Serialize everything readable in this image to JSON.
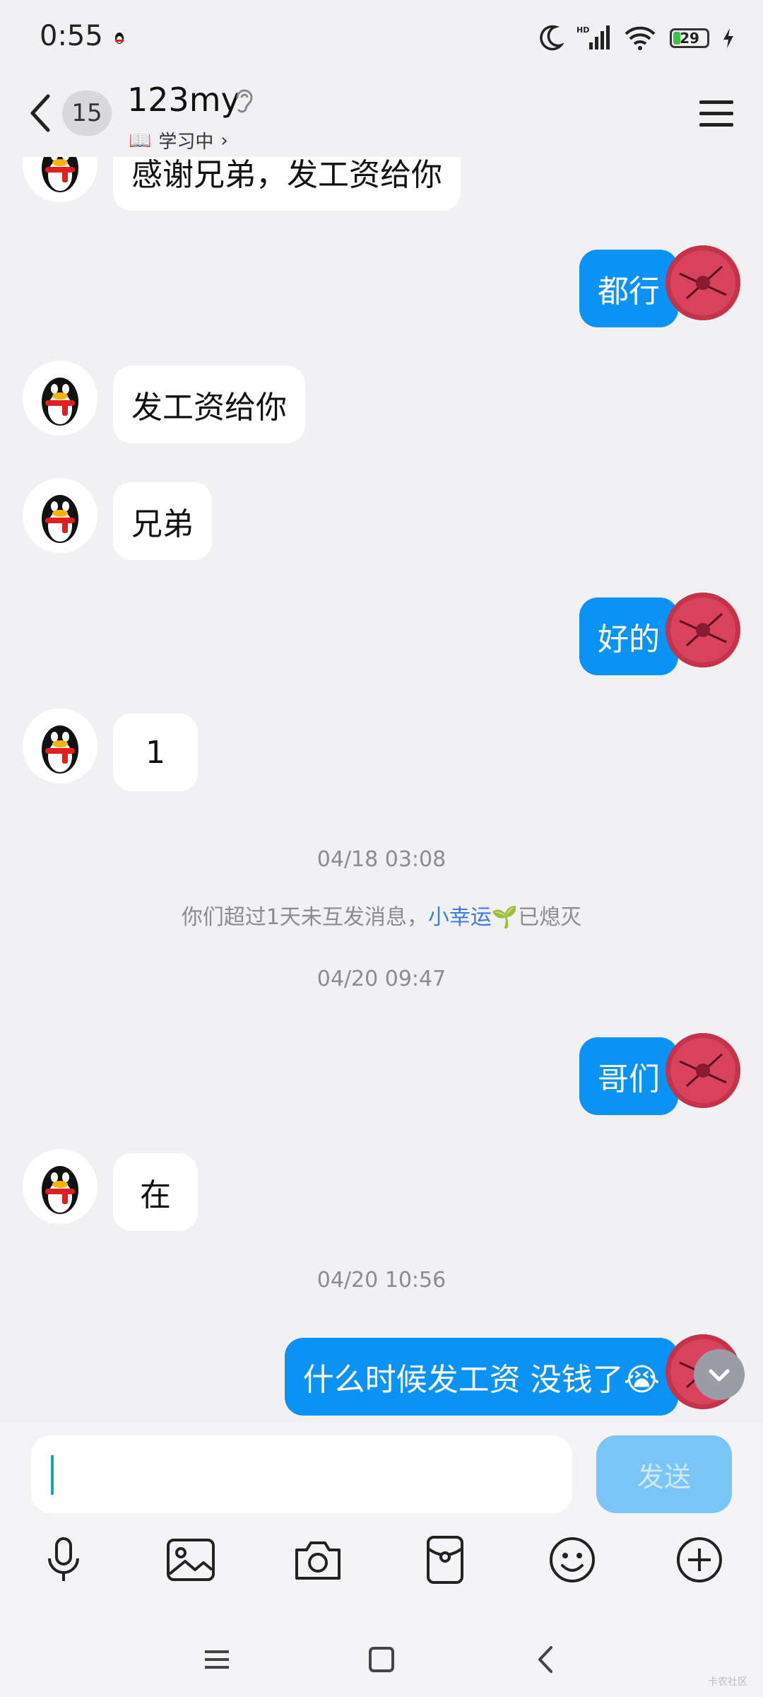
{
  "status_bar": {
    "time": "0:55",
    "battery": "29"
  },
  "header": {
    "back_label": "back",
    "unread_count": "15",
    "title": "123my",
    "status_icon": "📖",
    "status_text": "学习中",
    "status_arrow": "›"
  },
  "messages": [
    {
      "side": "left",
      "text": "感谢兄弟，发工资给你"
    },
    {
      "side": "right",
      "text": "都行"
    },
    {
      "side": "left",
      "text": "发工资给你"
    },
    {
      "side": "left",
      "text": "兄弟"
    },
    {
      "side": "right",
      "text": "好的"
    },
    {
      "side": "left",
      "text": "1"
    },
    {
      "side": "right",
      "text": "哥们"
    },
    {
      "side": "left",
      "text": "在"
    },
    {
      "side": "right",
      "text": "什么时候发工资  没钱了😭"
    }
  ],
  "timestamps": [
    "04/18 03:08",
    "04/20 09:47",
    "04/20 10:56"
  ],
  "system_notice": {
    "prefix": "你们超过1天未互发消息，",
    "link": "小幸运",
    "emoji": "🌱",
    "suffix": "已熄灭"
  },
  "input": {
    "placeholder": "",
    "send_label": "发送"
  },
  "toolbar": [
    "mic-icon",
    "image-icon",
    "camera-icon",
    "red-packet-icon",
    "emoji-icon",
    "plus-icon"
  ],
  "nav": [
    "menu-icon",
    "home-icon",
    "back-icon"
  ],
  "watermark": "卡农社区",
  "colors": {
    "bubble_self": "#0a93f5",
    "bubble_other": "#ffffff",
    "send_button": "#7bc4f6",
    "background": "#f1f1f3",
    "link": "#3a7ce0"
  }
}
